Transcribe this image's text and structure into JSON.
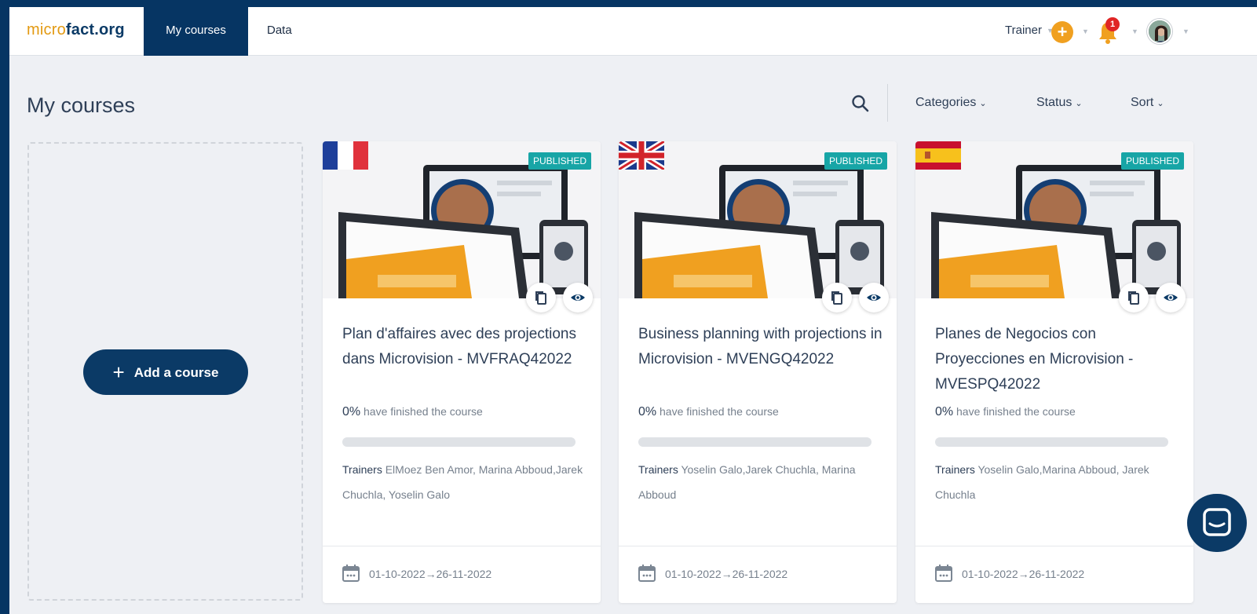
{
  "nav": {
    "logo_part1": "micro",
    "logo_part2": "fact.org",
    "tabs": [
      {
        "label": "My courses"
      },
      {
        "label": "Data"
      }
    ],
    "role": "Trainer",
    "notification_count": "1"
  },
  "page": {
    "title": "My courses",
    "filters": [
      {
        "label": "Categories"
      },
      {
        "label": "Status"
      },
      {
        "label": "Sort"
      }
    ]
  },
  "add_course": {
    "label": "Add a course"
  },
  "courses": [
    {
      "flag": "france-flag",
      "status": "PUBLISHED",
      "title": "Plan d'affaires avec des projections dans Microvision - MVFRAQ42022",
      "progress_pct": "0%",
      "progress_text": "have finished the course",
      "progress_value": 0,
      "trainers_label": "Trainers",
      "trainers": "ElMoez Ben Amor, Marina Abboud,Jarek Chuchla, Yoselin Galo",
      "dates": "01-10-2022→26-11-2022"
    },
    {
      "flag": "uk-flag",
      "status": "PUBLISHED",
      "title": "Business planning with projections in Microvision - MVENGQ42022",
      "progress_pct": "0%",
      "progress_text": "have finished the course",
      "progress_value": 0,
      "trainers_label": "Trainers",
      "trainers": "Yoselin Galo,Jarek Chuchla, Marina Abboud",
      "dates": "01-10-2022→26-11-2022"
    },
    {
      "flag": "spain-flag",
      "status": "PUBLISHED",
      "title": "Planes de Negocios con Proyecciones en Microvision - MVESPQ42022",
      "progress_pct": "0%",
      "progress_text": "have finished the course",
      "progress_value": 0,
      "trainers_label": "Trainers",
      "trainers": "Yoselin Galo,Marina Abboud, Jarek Chuchla",
      "dates": "01-10-2022→26-11-2022"
    }
  ],
  "colors": {
    "brand_navy": "#063563",
    "brand_orange": "#e39a12",
    "published_teal": "#17a5a6",
    "badge_red": "#e02525"
  }
}
